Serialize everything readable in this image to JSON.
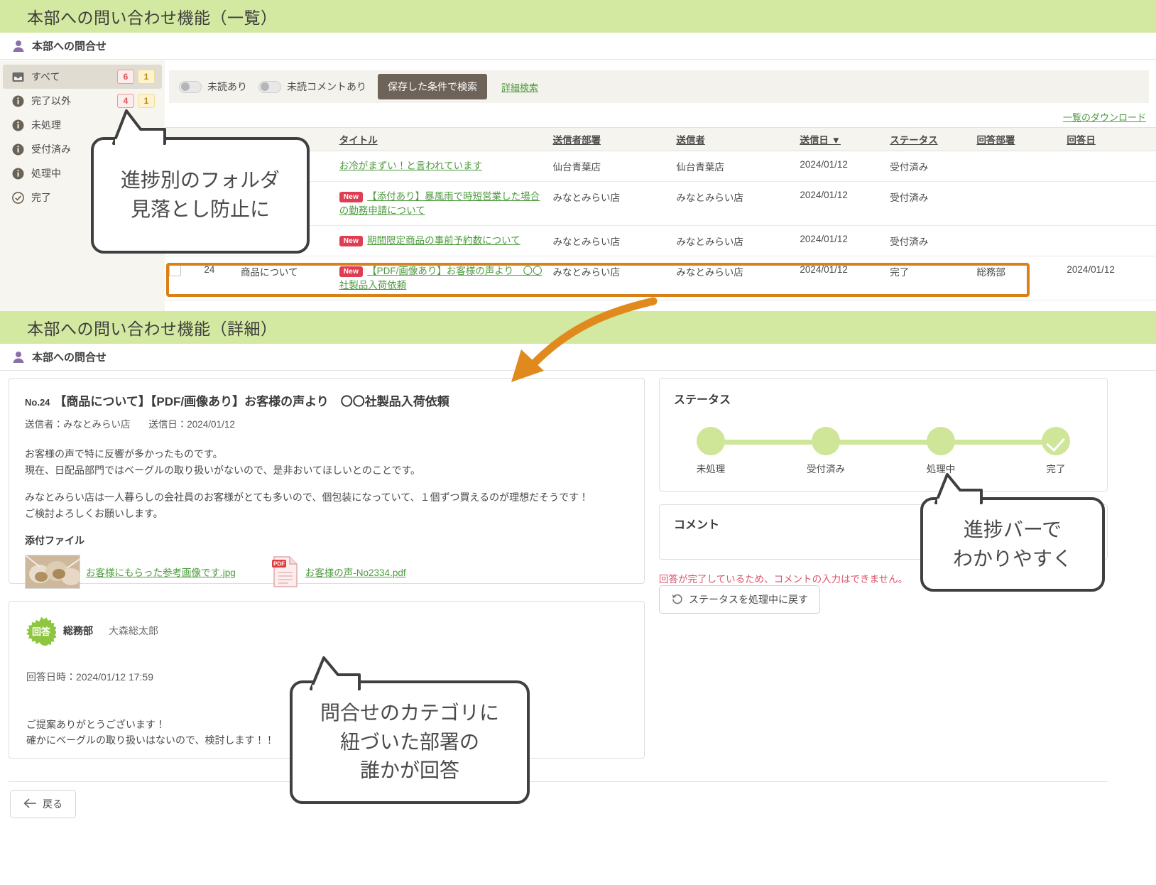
{
  "sections": {
    "list_banner": "本部への問い合わせ機能（一覧）",
    "detail_banner": "本部への問い合わせ機能（詳細）",
    "page_head": "本部への問合せ"
  },
  "sidebar": {
    "items": [
      {
        "label": "すべて",
        "icon": "inbox-icon",
        "badge_red": "6",
        "badge_yellow": "1",
        "active": true
      },
      {
        "label": "完了以外",
        "icon": "info-icon",
        "badge_red": "4",
        "badge_yellow": "1",
        "active": false
      },
      {
        "label": "未処理",
        "icon": "info-icon",
        "badge_red": "",
        "badge_yellow": "",
        "active": false
      },
      {
        "label": "受付済み",
        "icon": "info-icon",
        "badge_red": "",
        "badge_yellow": "",
        "active": false
      },
      {
        "label": "処理中",
        "icon": "info-icon",
        "badge_red": "",
        "badge_yellow": "",
        "active": false
      },
      {
        "label": "完了",
        "icon": "check-circle-icon",
        "badge_red": "",
        "badge_yellow": "",
        "active": false
      }
    ]
  },
  "filter_bar": {
    "toggle_unread_label": "未読あり",
    "toggle_unread_comment_label": "未読コメントあり",
    "saved_search_button": "保存した条件で検索",
    "detail_search_link": "詳細検索"
  },
  "list": {
    "download_link": "一覧のダウンロード",
    "columns": {
      "checkbox": "",
      "no": "",
      "category": "",
      "title": "タイトル",
      "sender_dept": "送信者部署",
      "sender": "送信者",
      "sent_date": "送信日 ▼",
      "status": "ステータス",
      "reply_dept": "回答部署",
      "reply_date": "回答日"
    },
    "rows": [
      {
        "no": "",
        "category": "",
        "new": false,
        "title": "お冷がまずい！と言われています",
        "sender_dept": "仙台青葉店",
        "sender": "仙台青葉店",
        "sent_date": "2024/01/12",
        "status": "受付済み",
        "reply_dept": "",
        "reply_date": "",
        "highlight": false
      },
      {
        "no": "",
        "category": "",
        "new": true,
        "new_label": "New",
        "title": "【添付あり】暴風雨で時短営業した場合の勤務申請について",
        "sender_dept": "みなとみらい店",
        "sender": "みなとみらい店",
        "sent_date": "2024/01/12",
        "status": "受付済み",
        "reply_dept": "",
        "reply_date": "",
        "highlight": false
      },
      {
        "no": "",
        "category": "",
        "new": true,
        "new_label": "New",
        "title": "期間限定商品の事前予約数について",
        "sender_dept": "みなとみらい店",
        "sender": "みなとみらい店",
        "sent_date": "2024/01/12",
        "status": "受付済み",
        "reply_dept": "",
        "reply_date": "",
        "highlight": false
      },
      {
        "no": "24",
        "category": "商品について",
        "new": true,
        "new_label": "New",
        "title": "【PDF/画像あり】お客様の声より　〇〇社製品入荷依頼",
        "sender_dept": "みなとみらい店",
        "sender": "みなとみらい店",
        "sent_date": "2024/01/12",
        "status": "完了",
        "reply_dept": "総務部",
        "reply_date": "2024/01/12",
        "highlight": true
      }
    ]
  },
  "detail": {
    "inquiry": {
      "no": "No.24",
      "title": "【商品について】【PDF/画像あり】お客様の声より　〇〇社製品入荷依頼",
      "sender_label": "送信者：みなとみらい店",
      "sent_label": "送信日：2024/01/12",
      "body_p1_line1": "お客様の声で特に反響が多かったものです。",
      "body_p1_line2": "現在、日配品部門ではベーグルの取り扱いがないので、是非おいてほしいとのことです。",
      "body_p2_line1": "みなとみらい店は一人暮らしの会社員のお客様がとても多いので、個包装になっていて、１個ずつ買えるのが理想だそうです！",
      "body_p2_line2": "ご検討よろしくお願いします。",
      "attachment_head": "添付ファイル",
      "attachments": [
        {
          "name": "お客様にもらった参考画像です.jpg",
          "type": "image"
        },
        {
          "name": "お客様の声-No2334.pdf",
          "type": "pdf",
          "badge": "PDF"
        }
      ]
    },
    "status_card": {
      "title": "ステータス",
      "steps": [
        {
          "label": "未処理",
          "done": false
        },
        {
          "label": "受付済み",
          "done": false
        },
        {
          "label": "処理中",
          "done": false
        },
        {
          "label": "完了",
          "done": true
        }
      ]
    },
    "comment_card": {
      "title": "コメント",
      "disabled_note": "回答が完了しているため、コメントの入力はできません。",
      "revert_button": "ステータスを処理中に戻す"
    },
    "reply": {
      "badge": "回答",
      "dept": "総務部",
      "name": "大森総太郎",
      "date_label": "回答日時：2024/01/12 17:59",
      "body_line1": "ご提案ありがとうございます！",
      "body_line2": "確かにベーグルの取り扱いはないので、検討します！！"
    },
    "back_button": "戻る"
  },
  "callouts": [
    {
      "id": "callout-1",
      "line1": "進捗別のフォルダ",
      "line2": "見落とし防止に"
    },
    {
      "id": "callout-2",
      "line1": "進捗バーで",
      "line2": "わかりやすく"
    },
    {
      "id": "callout-3",
      "line1": "問合せのカテゴリに",
      "line2": "紐づいた部署の",
      "line3": "誰かが回答"
    }
  ],
  "colors": {
    "banner_green": "#d3e8a0",
    "link_green": "#4e9a3e",
    "highlight_orange": "#d98019",
    "new_red": "#e03c52",
    "error_red": "#d9546a",
    "step_green": "#cfe598",
    "badge_green": "#8ec63f"
  }
}
